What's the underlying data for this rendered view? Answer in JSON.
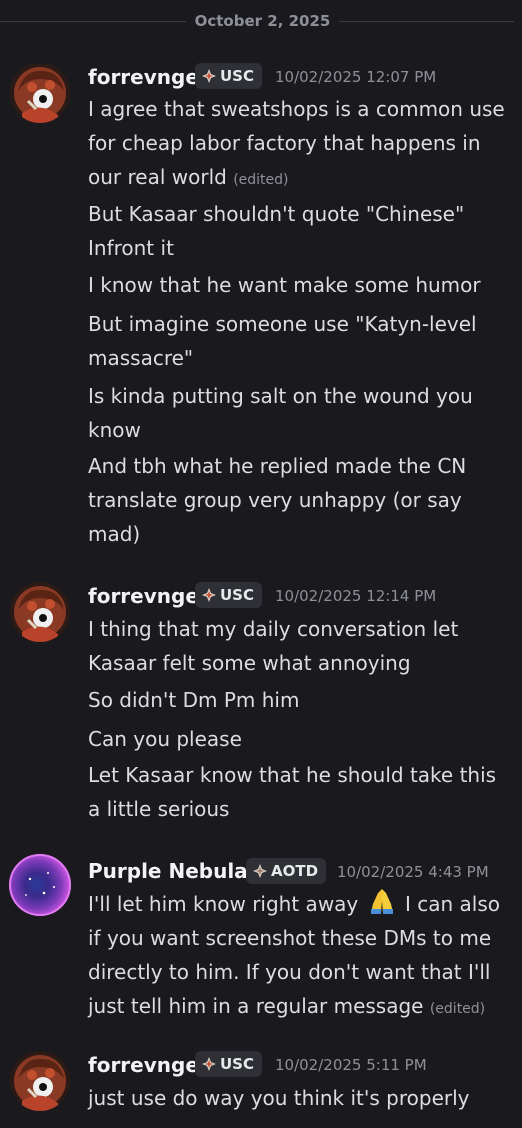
{
  "divider": {
    "date": "October 2, 2025"
  },
  "messages": [
    {
      "username": "forrevnge",
      "tag": "USC",
      "timestamp": "10/02/2025 12:07 PM",
      "lines": [
        {
          "text": "I agree that sweatshops is a common use for cheap labor factory that happens in our real world",
          "edited": "(edited)"
        },
        {
          "text": "But Kasaar shouldn't quote \"Chinese\" Infront it"
        },
        {
          "text": "I know that he want make some humor"
        },
        {
          "text": "But imagine someone use \"Katyn-level massacre\""
        },
        {
          "text": "Is kinda putting salt on the wound you know"
        },
        {
          "text": "And tbh what he replied made the CN translate group very unhappy (or say mad)"
        }
      ]
    },
    {
      "username": "forrevnge",
      "tag": "USC",
      "timestamp": "10/02/2025 12:14 PM",
      "lines": [
        {
          "text": "I thing that my daily conversation let Kasaar felt some what annoying"
        },
        {
          "text": "So didn't Dm Pm him"
        },
        {
          "text": "Can you please"
        },
        {
          "text": "Let Kasaar know that he should take this a little serious"
        }
      ]
    },
    {
      "username": "Purple Nebula",
      "tag": "AOTD",
      "timestamp": "10/02/2025 4:43 PM",
      "lines": [
        {
          "text_before": "I'll let him know right away",
          "emoji": "folded-hands-emoji",
          "text_after": "I can also if you want screenshot these DMs to me directly to him. If you don't want that I'll just tell him in a regular message",
          "edited": "(edited)"
        }
      ]
    },
    {
      "username": "forrevnge",
      "tag": "USC",
      "timestamp": "10/02/2025 5:11 PM",
      "lines": [
        {
          "text": "just use do way you think it's properly"
        }
      ]
    }
  ],
  "icons": {
    "tag_icon": "diamond-sparkle-icon",
    "avatar_1": "red-character-avatar",
    "avatar_2": "purple-nebula-avatar"
  },
  "colors": {
    "background": "#1a1a1e",
    "username": "#f2f3f5",
    "text": "#dcdde1",
    "muted": "#8e9098",
    "tag_bg": "#2e3036"
  }
}
